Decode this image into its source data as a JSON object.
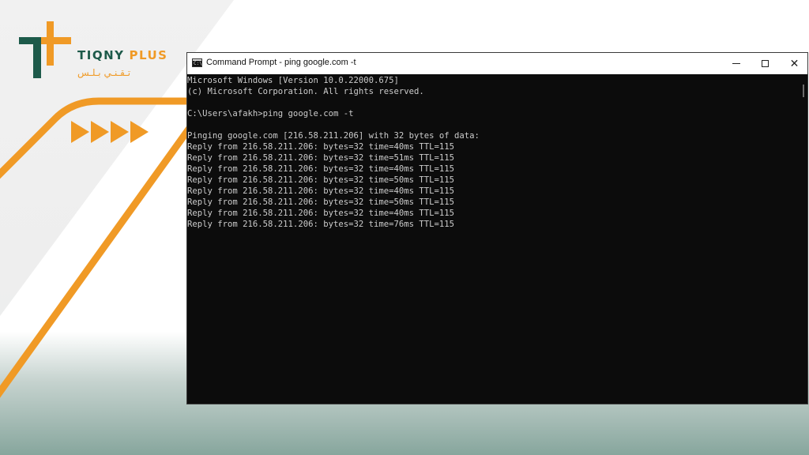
{
  "branding": {
    "logo_latin": "TIQNY",
    "logo_plus": "PLUS",
    "logo_arabic": "تـقـنـي  بـلـس",
    "colors": {
      "green": "#1d5a4a",
      "orange": "#f09a26"
    }
  },
  "window": {
    "title": "Command Prompt - ping  google.com -t",
    "icon": "cmd-icon",
    "icon_text": "C:\\",
    "controls": [
      "minimize-icon",
      "maximize-icon",
      "close-icon"
    ],
    "close_glyph": "✕"
  },
  "console": {
    "lines": [
      "Microsoft Windows [Version 10.0.22000.675]",
      "(c) Microsoft Corporation. All rights reserved.",
      "",
      "C:\\Users\\afakh>ping google.com -t",
      "",
      "Pinging google.com [216.58.211.206] with 32 bytes of data:",
      "Reply from 216.58.211.206: bytes=32 time=40ms TTL=115",
      "Reply from 216.58.211.206: bytes=32 time=51ms TTL=115",
      "Reply from 216.58.211.206: bytes=32 time=40ms TTL=115",
      "Reply from 216.58.211.206: bytes=32 time=50ms TTL=115",
      "Reply from 216.58.211.206: bytes=32 time=40ms TTL=115",
      "Reply from 216.58.211.206: bytes=32 time=50ms TTL=115",
      "Reply from 216.58.211.206: bytes=32 time=40ms TTL=115",
      "Reply from 216.58.211.206: bytes=32 time=76ms TTL=115"
    ]
  }
}
